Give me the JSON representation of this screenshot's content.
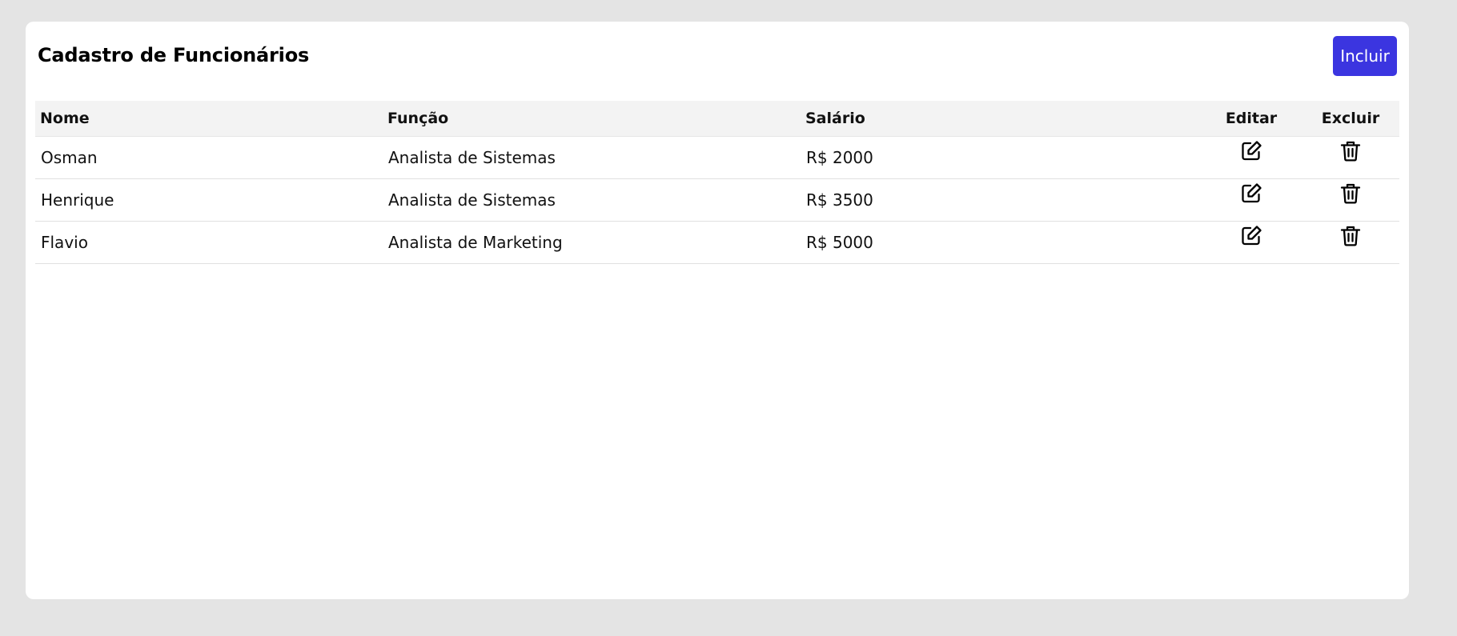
{
  "header": {
    "title": "Cadastro de Funcionários",
    "add_label": "Incluir"
  },
  "colors": {
    "accent": "#3b35e0",
    "background": "#e4e4e4",
    "card": "#ffffff",
    "table_header": "#f3f3f3"
  },
  "table": {
    "columns": [
      "Nome",
      "Função",
      "Salário",
      "Editar",
      "Excluir"
    ],
    "rows": [
      {
        "nome": "Osman",
        "funcao": "Analista de Sistemas",
        "salario": "R$ 2000",
        "edit_icon": "edit-icon",
        "delete_icon": "trash-icon"
      },
      {
        "nome": "Henrique",
        "funcao": "Analista de Sistemas",
        "salario": "R$ 3500",
        "edit_icon": "edit-icon",
        "delete_icon": "trash-icon"
      },
      {
        "nome": "Flavio",
        "funcao": "Analista de Marketing",
        "salario": "R$ 5000",
        "edit_icon": "edit-icon",
        "delete_icon": "trash-icon"
      }
    ]
  }
}
